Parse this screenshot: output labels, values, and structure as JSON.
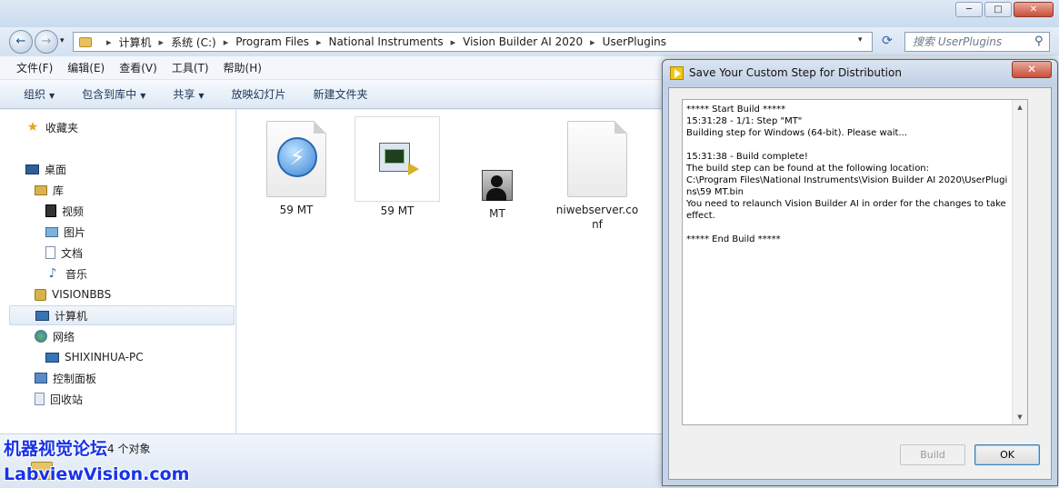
{
  "explorer": {
    "window_controls": {
      "minimize": "─",
      "maximize": "□",
      "close": "✕"
    },
    "nav": {
      "back_icon": "←",
      "forward_icon": "→",
      "history_icon": "▾"
    },
    "breadcrumbs": [
      "计算机",
      "系统 (C:)",
      "Program Files",
      "National Instruments",
      "Vision Builder AI 2020",
      "UserPlugins"
    ],
    "breadcrumb_separator": "▸",
    "address_dropdown_icon": "▾",
    "refresh_icon": "⟳",
    "search": {
      "placeholder": "搜索 UserPlugins",
      "icon": "⚲"
    },
    "menu": [
      "文件(F)",
      "编辑(E)",
      "查看(V)",
      "工具(T)",
      "帮助(H)"
    ],
    "commands": [
      {
        "label": "组织",
        "dropdown": true
      },
      {
        "label": "包含到库中",
        "dropdown": true
      },
      {
        "label": "共享",
        "dropdown": true
      },
      {
        "label": "放映幻灯片",
        "dropdown": false
      },
      {
        "label": "新建文件夹",
        "dropdown": false
      }
    ],
    "command_caret": "▼",
    "sidebar": {
      "favorites": "收藏夹",
      "desktop": "桌面",
      "library": "库",
      "videos": "视频",
      "pictures": "图片",
      "documents": "文档",
      "music": "音乐",
      "user": "VISIONBBS",
      "computer": "计算机",
      "network": "网络",
      "network_pc": "SHIXINHUA-PC",
      "control_panel": "控制面板",
      "recycle_bin": "回收站",
      "icons": {
        "star": "★",
        "music": "♪"
      }
    },
    "files": [
      {
        "name": "59 MT",
        "icon": "lightning-document-icon"
      },
      {
        "name": "59 MT",
        "icon": "vision-builder-icon"
      },
      {
        "name": "MT",
        "icon": "user-tool-icon"
      },
      {
        "name": "niwebserver.conf",
        "icon": "blank-document-icon"
      }
    ],
    "bolt_glyph": "⚡",
    "status_text": "4 个对象"
  },
  "watermark": {
    "line1": "机器视觉论坛",
    "line2": "LabviewVision.com"
  },
  "dialog": {
    "title": "Save Your Custom Step for Distribution",
    "close_icon": "✕",
    "log_lines": [
      "***** Start Build *****",
      "15:31:28 - 1/1: Step \"MT\"",
      "Building step for Windows (64-bit). Please wait...",
      "",
      "15:31:38 - Build complete!",
      "The build step can be found at the following location:",
      "C:\\Program Files\\National Instruments\\Vision Builder AI 2020\\UserPlugins\\59 MT.bin",
      "You need to relaunch Vision Builder AI in order for the changes to take effect.",
      "",
      "***** End Build *****"
    ],
    "scroll_up": "▲",
    "scroll_down": "▼",
    "build_label": "Build",
    "ok_label": "OK"
  }
}
